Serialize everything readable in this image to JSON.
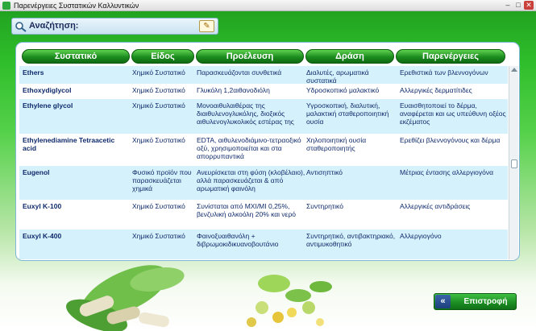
{
  "window": {
    "title": "Παρενέργειες Συστατικών Καλλυντικών",
    "min_glyph": "–",
    "max_glyph": "□",
    "close_glyph": "✕"
  },
  "search": {
    "label": "Αναζήτηση:",
    "go_glyph": "✎"
  },
  "table": {
    "headers": [
      "Συστατικό",
      "Είδος",
      "Προέλευση",
      "Δράση",
      "Παρενέργειες"
    ],
    "rows": [
      {
        "name": "Ethers",
        "type": "Χημικό Συστατικό",
        "source": "Παρασκευάζονται συνθετικά",
        "action": "Διαλυτές, αρωματικά συστατικά",
        "side_effects": "Ερεθιστικά των βλεννογόνων"
      },
      {
        "name": "Ethoxydiglycol",
        "type": "Χημικό Συστατικό",
        "source": "Γλυκόλη 1,2αιθανοδιόλη",
        "action": "Υδροσκοπικό μαλακτικό",
        "side_effects": "Αλλεργικές δερματίτιδες"
      },
      {
        "name": "Ethylene glycol",
        "type": "Χημικό Συστατικό",
        "source": "Μονοαιθυλαιθέρας της διαιθυλενογλυκόλης, διοξικός αιθυλενογλυκολικός εστέρας της",
        "action": "Υγροσκοπική, διαλυτική, μαλακτική σταθεροποιητική ουσία",
        "side_effects": "Ευαισθητοποιεί το δέρμα, αναφέρεται και ως υπεύθυνη οξέος εκζέματος"
      },
      {
        "name": "Ethylenediamine Tetraacetic acid",
        "type": "Χημικό Συστατικό",
        "source": "EDTA, αιθυλενοδιάμινο-τετραοξικό οξύ, χρησιμοποιείται και στα απορρυπαντικά",
        "action": "Χηλοποιητική ουσία σταθεροποιητής",
        "side_effects": "Ερεθίζει βλεννογόνους και δέρμα"
      },
      {
        "name": "Eugenol",
        "type": "Φυσικό προϊόν που παρασκευάζεται χημικά",
        "source": "Ανευρίσκεται στη φύση (κλοβέλαιο), αλλά παρασκευάζεται & από αρωματική φαινόλη",
        "action": "Αντισηπτικό",
        "side_effects": "Μέτριας έντασης αλλεργιογόνα"
      },
      {
        "name": "Euxyl K-100",
        "type": "Χημικό Συστατικό",
        "source": "Συνίσταται από ΜΧΙ/ΜΙ 0,25%, βενζυλική αλκοόλη 20% και νερό",
        "action": "Συντηρητικό",
        "side_effects": "Αλλεργικές αντιδράσεις"
      },
      {
        "name": "Euxyl K-400",
        "type": "Χημικό Συστατικό",
        "source": "Φαινοξυαιθανόλη + διβρωμοκιδικυανοβουτάνιο",
        "action": "Συντηρητικό, αντιβακτηριακό, αντιμυκοθητικό",
        "side_effects": "Αλλεργιογόνο"
      }
    ]
  },
  "back_button": {
    "label": "Επιστροφή",
    "chevron_glyph": "«"
  },
  "colors": {
    "header_green": "#1c8c1f",
    "row_stripe": "#d5f1fb",
    "text_navy": "#0f2a6b"
  }
}
